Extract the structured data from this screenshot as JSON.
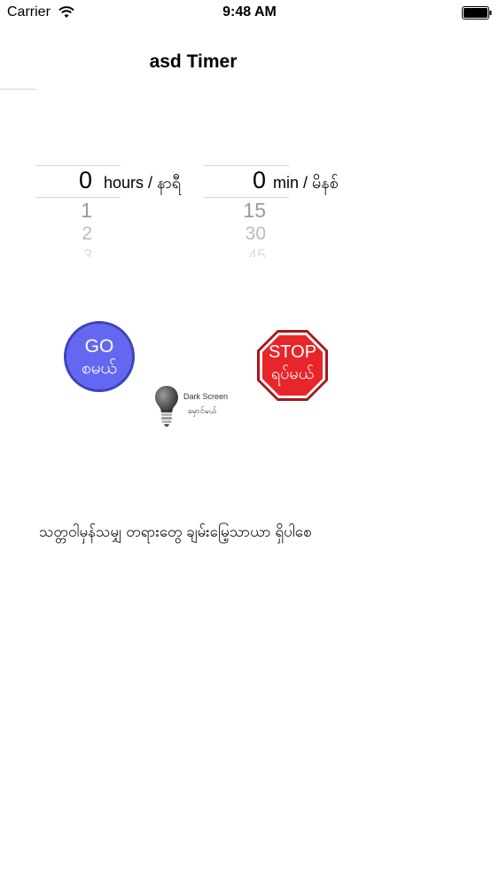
{
  "status_bar": {
    "carrier": "Carrier",
    "time": "9:48 AM"
  },
  "nav": {
    "title": "asd Timer"
  },
  "hours_picker": {
    "selected": "0",
    "rows": [
      "1",
      "2",
      "3"
    ],
    "unit_label": "hours / နာရီ"
  },
  "minutes_picker": {
    "selected": "0",
    "rows": [
      "15",
      "30",
      "45"
    ],
    "unit_label": "min / မိနစ်"
  },
  "go_button": {
    "label": "GO",
    "sub_label": "စမယ်",
    "color": "#6468f0"
  },
  "stop_button": {
    "label": "STOP",
    "sub_label": "ရပ်မယ်",
    "color": "#e8262a"
  },
  "dark_screen": {
    "label": "Dark Screen",
    "sub_label": "မှောင်မယ်",
    "icon": "lightbulb-icon"
  },
  "message": {
    "text": "သတ္တဝါမှန်သမျှ တရားတွေ ချမ်းမြေ့သာယာ ရှိပါစေ"
  }
}
